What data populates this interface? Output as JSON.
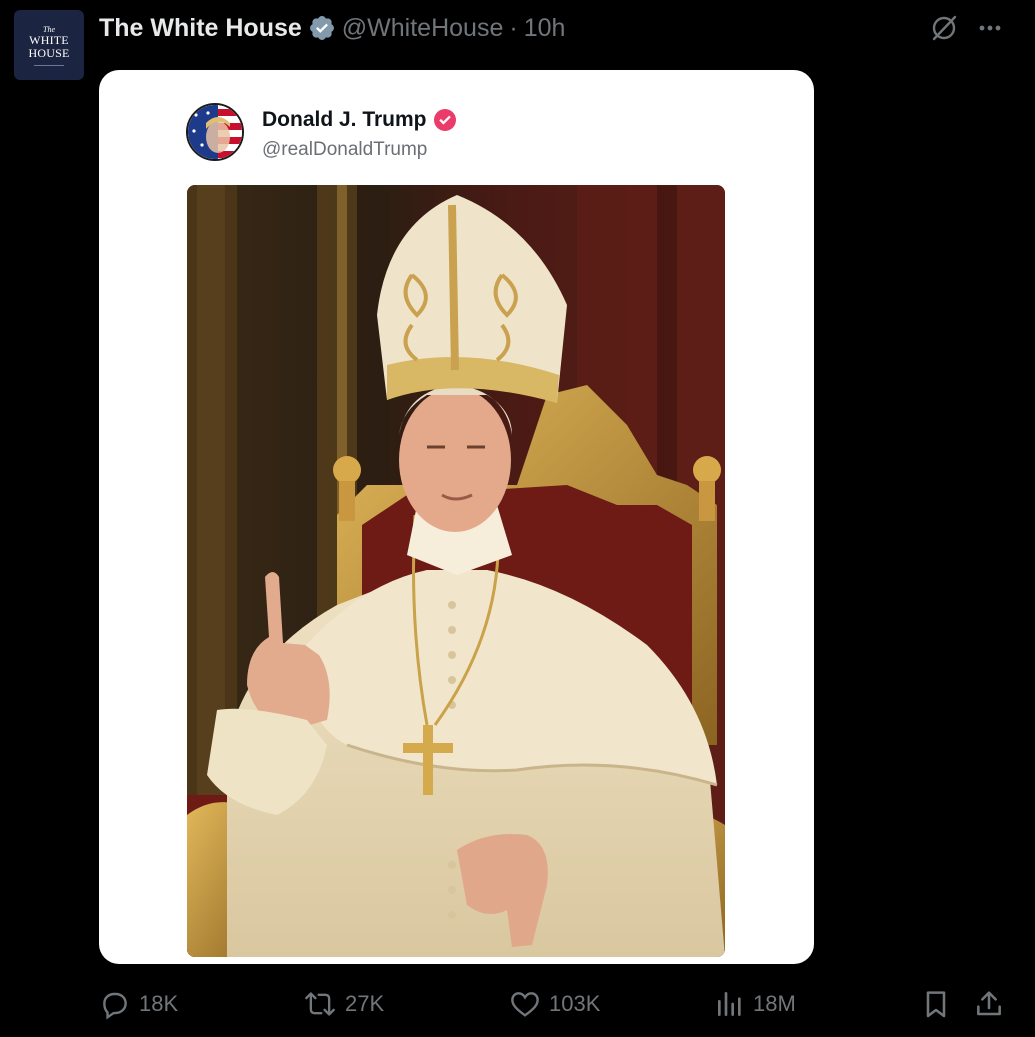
{
  "author": {
    "name": "The White House",
    "handle": "@WhiteHouse",
    "separator": "·",
    "time": "10h",
    "avatar_text": {
      "the": "The",
      "line1": "WHITE",
      "line2": "HOUSE"
    }
  },
  "quoted": {
    "name": "Donald J. Trump",
    "handle": "@realDonaldTrump"
  },
  "actions": {
    "replies": "18K",
    "reposts": "27K",
    "likes": "103K",
    "views": "18M"
  },
  "icons": {
    "verified": "verified-badge-icon",
    "quoted_badge": "verified-badge-icon",
    "grok": "grok-icon",
    "more": "more-dots-icon",
    "reply": "reply-icon",
    "repost": "repost-icon",
    "like": "heart-icon",
    "views": "views-icon",
    "bookmark": "bookmark-icon",
    "share": "share-icon"
  },
  "colors": {
    "background": "#000000",
    "text_primary": "#e7e9ea",
    "text_secondary": "#71767b",
    "card_background": "#ffffff",
    "quoted_badge": "#ea3b6b",
    "avatar_background": "#1b2440"
  }
}
